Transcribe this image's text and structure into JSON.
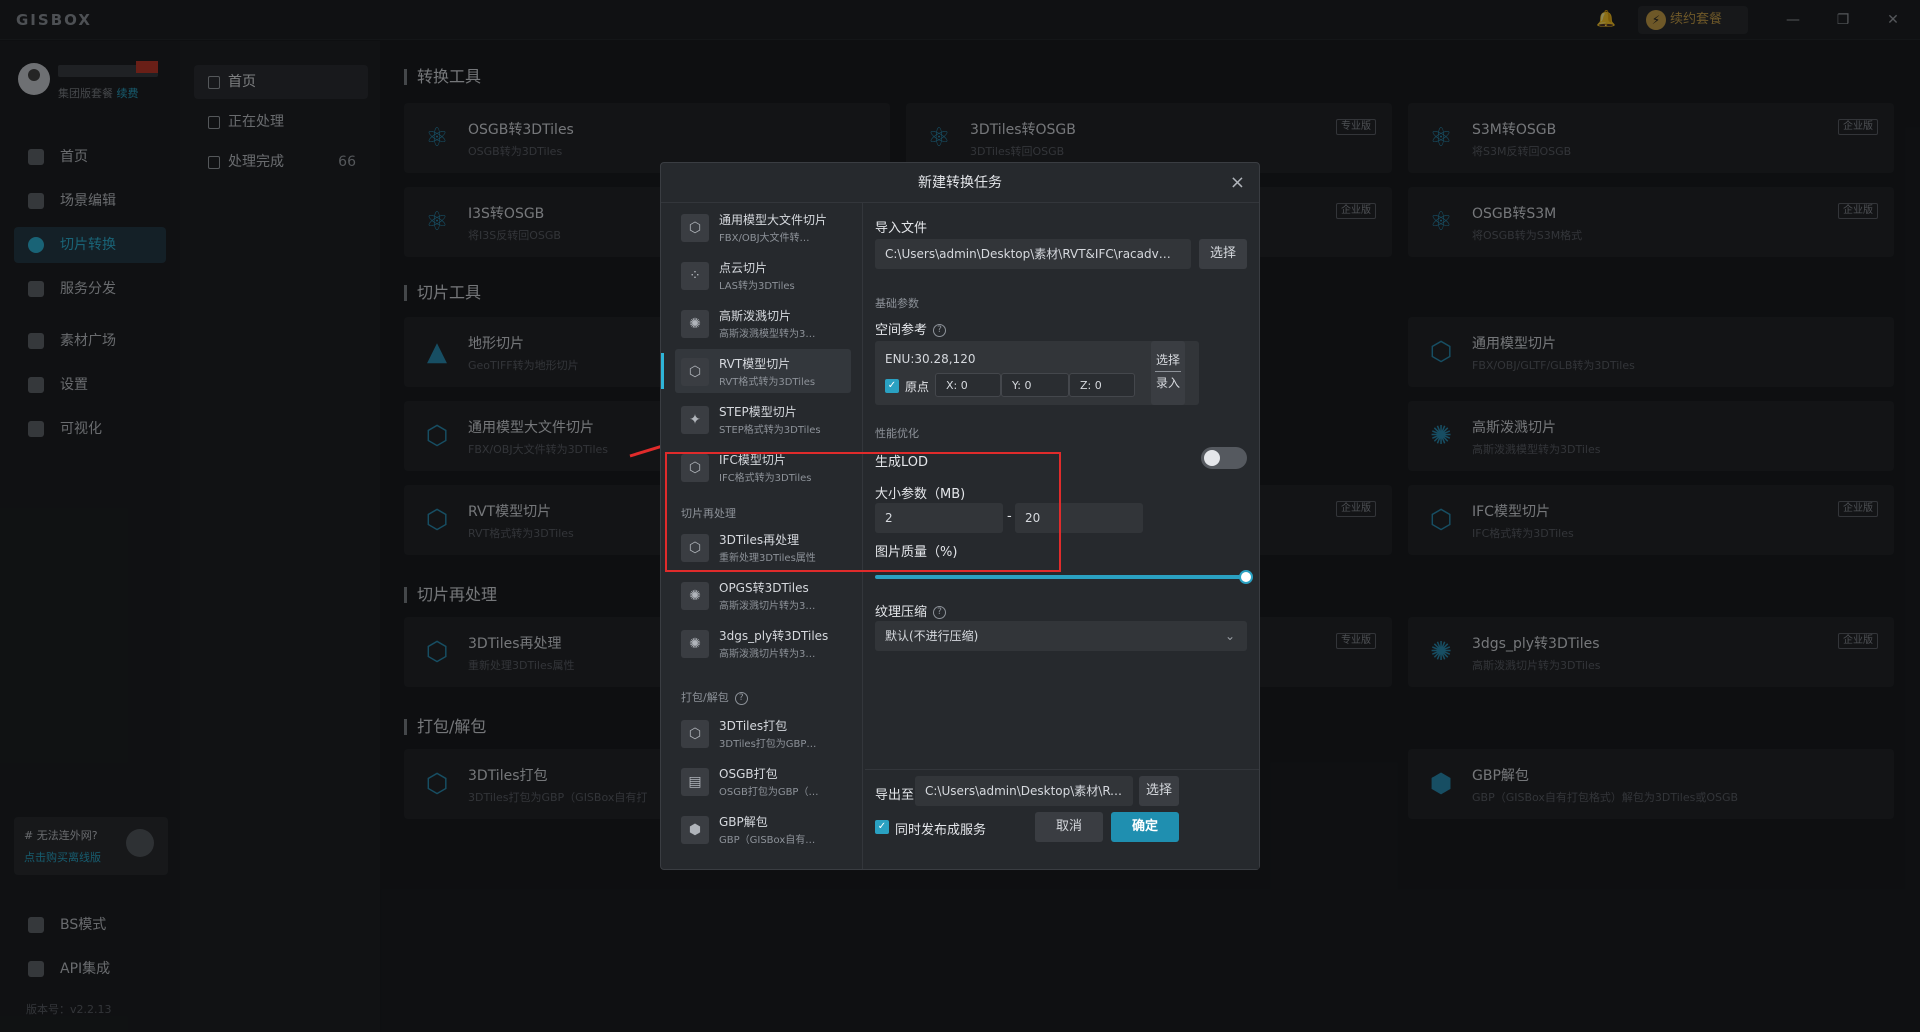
{
  "app": {
    "logo": "GISBOX",
    "renew_label": "续约套餐"
  },
  "user": {
    "plan": "集团版套餐",
    "renew_link": "续费"
  },
  "sidebar": {
    "items": [
      {
        "label": "首页"
      },
      {
        "label": "场景编辑"
      },
      {
        "label": "切片转换"
      },
      {
        "label": "服务分发"
      },
      {
        "label": "素材广场"
      },
      {
        "label": "设置"
      },
      {
        "label": "可视化"
      }
    ],
    "promo_title": "# 无法连外网?",
    "promo_link": "点击购买离线版",
    "bottom_items": [
      {
        "label": "BS模式"
      },
      {
        "label": "API集成"
      }
    ],
    "version": "版本号：v2.2.13"
  },
  "subnav": {
    "items": [
      {
        "label": "首页"
      },
      {
        "label": "正在处理"
      },
      {
        "label": "处理完成",
        "count": "66"
      }
    ]
  },
  "sections": {
    "convert": "转换工具",
    "tile": "切片工具",
    "reprocess": "切片再处理",
    "pack": "打包/解包"
  },
  "cards": [
    {
      "title": "OSGB转3DTiles",
      "sub": "OSGB转为3DTiles",
      "badge": ""
    },
    {
      "title": "3DTiles转OSGB",
      "sub": "3DTiles转回OSGB",
      "badge": "专业版"
    },
    {
      "title": "S3M转OSGB",
      "sub": "将S3M反转回OSGB",
      "badge": "企业版"
    },
    {
      "title": "I3S转OSGB",
      "sub": "将I3S反转回OSGB",
      "badge": ""
    },
    {
      "title": "",
      "sub": "",
      "badge": "企业版"
    },
    {
      "title": "OSGB转S3M",
      "sub": "将OSGB转为S3M格式",
      "badge": "企业版"
    },
    {
      "title": "地形切片",
      "sub": "GeoTIFF转为地形切片",
      "badge": ""
    },
    {
      "title": "通用模型切片",
      "sub": "FBX/OBJ/GLTF/GLB转为3DTiles",
      "badge": ""
    },
    {
      "title": "通用模型大文件切片",
      "sub": "FBX/OBJ大文件转为3DTiles",
      "badge": ""
    },
    {
      "title": "高斯泼溅切片",
      "sub": "高斯泼溅模型转为3DTiles",
      "badge": ""
    },
    {
      "title": "RVT模型切片",
      "sub": "RVT格式转为3DTiles",
      "badge": ""
    },
    {
      "title": "",
      "sub": "",
      "badge": "企业版"
    },
    {
      "title": "IFC模型切片",
      "sub": "IFC格式转为3DTiles",
      "badge": "企业版"
    },
    {
      "title": "3DTiles再处理",
      "sub": "重新处理3DTiles属性",
      "badge": ""
    },
    {
      "title": "",
      "sub": "",
      "badge": "专业版"
    },
    {
      "title": "3dgs_ply转3DTiles",
      "sub": "高斯泼溅切片转为3DTiles",
      "badge": "企业版"
    },
    {
      "title": "3DTiles打包",
      "sub": "3DTiles打包为GBP（GISBox自有打",
      "badge": ""
    },
    {
      "title": "GBP解包",
      "sub": "GBP（GISBox自有打包格式）解包为3DTiles或OSGB",
      "badge": ""
    }
  ],
  "modal": {
    "title": "新建转换任务",
    "close": "×",
    "left_items": [
      {
        "title": "通用模型大文件切片",
        "sub": "FBX/OBJ大文件转…"
      },
      {
        "title": "点云切片",
        "sub": "LAS转为3DTiles"
      },
      {
        "title": "高斯泼溅切片",
        "sub": "高斯泼溅模型转为3…"
      },
      {
        "title": "RVT模型切片",
        "sub": "RVT格式转为3DTiles"
      },
      {
        "title": "STEP模型切片",
        "sub": "STEP格式转为3DTiles"
      },
      {
        "title": "IFC模型切片",
        "sub": "IFC格式转为3DTiles"
      }
    ],
    "group_reprocess": "切片再处理",
    "reprocess_items": [
      {
        "title": "3DTiles再处理",
        "sub": "重新处理3DTiles属性"
      },
      {
        "title": "OPGS转3DTiles",
        "sub": "高斯泼溅切片转为3…"
      },
      {
        "title": "3dgs_ply转3DTiles",
        "sub": "高斯泼溅切片转为3…"
      }
    ],
    "group_pack": "打包/解包",
    "pack_items": [
      {
        "title": "3DTiles打包",
        "sub": "3DTiles打包为GBP…"
      },
      {
        "title": "OSGB打包",
        "sub": "OSGB打包为GBP（…"
      },
      {
        "title": "GBP解包",
        "sub": "GBP（GISBox自有…"
      }
    ],
    "import_label": "导入文件",
    "import_path": "C:\\Users\\admin\\Desktop\\素材\\RVT&IFC\\racadv…",
    "select_btn": "选择",
    "basic_params": "基础参数",
    "spatial_ref": "空间参考",
    "enu_value": "ENU:30.28,120",
    "origin_label": "原点",
    "x_field": "X: 0",
    "y_field": "Y: 0",
    "z_field": "Z: 0",
    "select_top": "选择",
    "select_bottom": "录入",
    "perf_opt": "性能优化",
    "lod_label": "生成LOD",
    "size_label": "大小参数（MB)",
    "size_min": "2",
    "size_dash": "-",
    "size_max": "20",
    "quality_label": "图片质量（%)",
    "quality_value": 100,
    "texture_label": "纹理压缩",
    "texture_value": "默认(不进行压缩)",
    "export_label": "导出至",
    "export_path": "C:\\Users\\admin\\Desktop\\素材\\RVT&IFC…",
    "export_btn": "选择",
    "publish_label": "同时发布成服务",
    "cancel": "取消",
    "confirm": "确定"
  },
  "colors": {
    "accent": "#2aa1c2",
    "highlight_box": "#e02b2b",
    "arrow": "#e02b2b"
  }
}
